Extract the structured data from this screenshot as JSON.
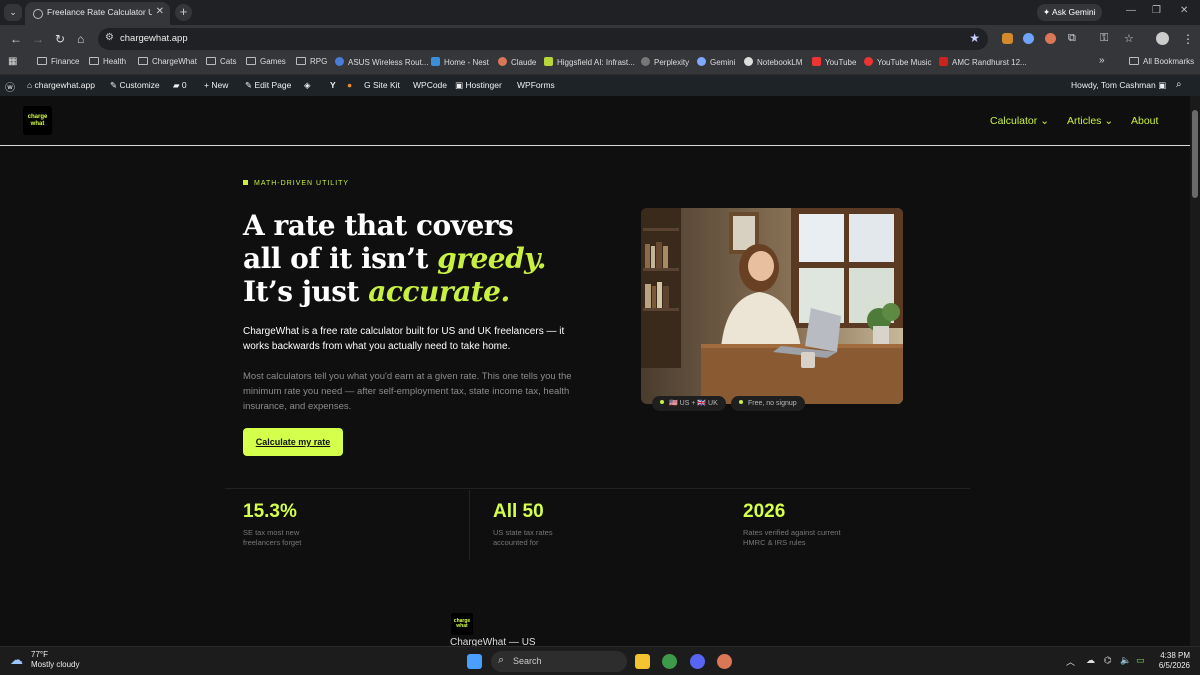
{
  "browser": {
    "tab_title": "Freelance Rate Calculator US (2",
    "url": "chargewhat.app",
    "ask_gemini": "Ask Gemini",
    "bookmarks": [
      "Finance",
      "Health",
      "ChargeWhat",
      "Cats",
      "Games",
      "RPG",
      "ASUS Wireless Rout...",
      "Home - Nest",
      "Claude",
      "Higgsfield AI: Infrast...",
      "Perplexity",
      "Gemini",
      "NotebookLM",
      "YouTube",
      "YouTube Music",
      "AMC Randhurst 12..."
    ],
    "all_bookmarks": "All Bookmarks"
  },
  "adminbar": {
    "site": "chargewhat.app",
    "customize": "Customize",
    "comments": "0",
    "new": "New",
    "edit_page": "Edit Page",
    "site_kit": "Site Kit",
    "wpcode": "WPCode",
    "hostinger": "Hostinger",
    "wpforms": "WPForms",
    "howdy": "Howdy, Tom Cashman"
  },
  "site": {
    "logo_line1": "charge",
    "logo_line2": "what",
    "nav": {
      "calculator": "Calculator",
      "articles": "Articles",
      "about": "About"
    },
    "eyebrow": "MATH-DRIVEN UTILITY",
    "headline": {
      "l1": "A rate that covers",
      "l2a": "all of it isn’t ",
      "l2b": "greedy.",
      "l3a": "It’s just ",
      "l3b": "accurate."
    },
    "lead": "ChargeWhat is a free rate calculator built for US and UK freelancers — it works backwards from what you actually need to take home.",
    "sub": "Most calculators tell you what you'd earn at a given rate. This one tells you the minimum rate you need — after self-employment tax, state income tax, health insurance, and expenses.",
    "cta": "Calculate my rate",
    "chips": [
      "🇺🇸 US + 🇬🇧 UK",
      "Free, no signup"
    ],
    "stats": [
      {
        "num": "15.3%",
        "label": "SE tax most new freelancers forget"
      },
      {
        "num": "All 50",
        "label": "US state tax rates accounted for"
      },
      {
        "num": "2026",
        "label": "Rates verified against current HMRC & IRS rules"
      }
    ],
    "footer_title": "ChargeWhat — US"
  },
  "taskbar": {
    "temp": "77°F",
    "weather": "Mostly cloudy",
    "search": "Search",
    "time": "4:38 PM",
    "date": "6/5/2026"
  }
}
